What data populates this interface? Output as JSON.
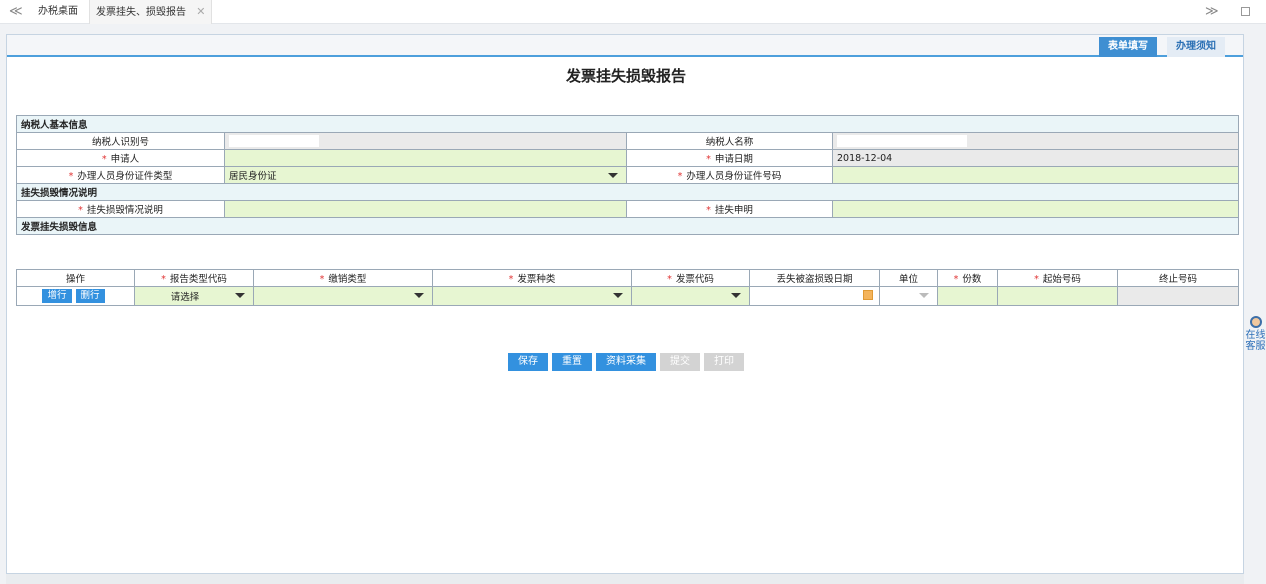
{
  "tabs": {
    "home": "办税桌面",
    "active": "发票挂失、损毁报告",
    "close": "✕",
    "nav_left": "≪",
    "nav_right": "≫"
  },
  "panel_tabs": {
    "fill": "表单填写",
    "notice": "办理须知"
  },
  "form_title": "发票挂失损毁报告",
  "sections": {
    "basic": "纳税人基本信息",
    "explain": "挂失损毁情况说明",
    "invoice": "发票挂失损毁信息"
  },
  "basic": {
    "taxpayer_id_label": "纳税人识别号",
    "taxpayer_name_label": "纳税人名称",
    "applicant_label": "申请人",
    "apply_date_label": "申请日期",
    "apply_date_value": "2018-12-04",
    "id_type_label": "办理人员身份证件类型",
    "id_type_value": "居民身份证",
    "id_number_label": "办理人员身份证件号码"
  },
  "explain": {
    "desc_label": "挂失损毁情况说明",
    "stmt_label": "挂失申明"
  },
  "invoice_table": {
    "headers": [
      "操作",
      "报告类型代码",
      "缴销类型",
      "发票种类",
      "发票代码",
      "丢失被盗损毁日期",
      "单位",
      "份数",
      "起始号码",
      "终止号码"
    ],
    "add_row": "增行",
    "del_row": "删行",
    "report_type_value": "请选择"
  },
  "buttons": {
    "save": "保存",
    "reset": "重置",
    "collect": "资料采集",
    "submit": "提交",
    "print": "打印"
  },
  "side_widget": {
    "line1": "在线",
    "line2": "客服"
  }
}
